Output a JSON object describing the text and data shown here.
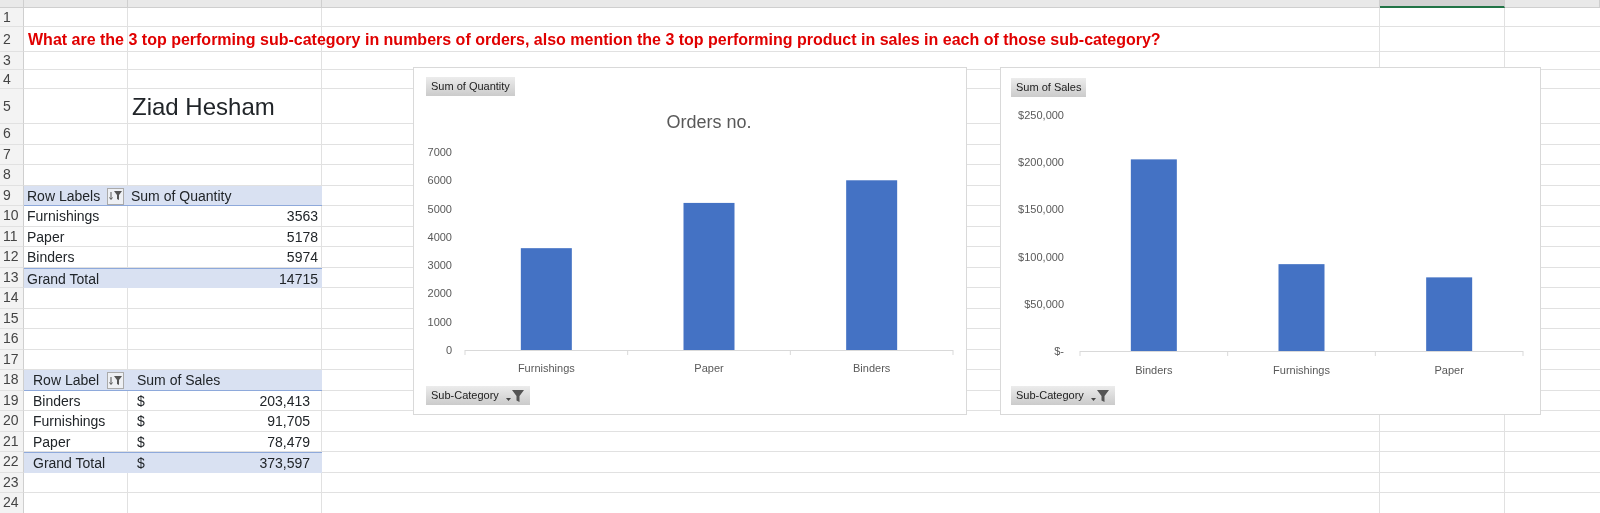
{
  "column_headers": [
    {
      "selected": false
    },
    {
      "selected": false
    },
    {
      "selected": false
    },
    {
      "selected": true
    },
    {
      "selected": false
    }
  ],
  "row_numbers": [
    "1",
    "2",
    "3",
    "4",
    "5",
    "6",
    "7",
    "8",
    "9",
    "10",
    "11",
    "12",
    "13",
    "14",
    "15",
    "16",
    "17",
    "18",
    "19",
    "20",
    "21",
    "22",
    "23",
    "24"
  ],
  "question": "What are the 3 top performing sub-category in numbers of orders, also mention the 3 top performing product in sales in each of those sub-category?",
  "author": "Ziad Hesham",
  "pivot_tables": [
    {
      "row_labels": "Row Labels",
      "value_header": "Sum of Quantity",
      "rows": [
        {
          "label": "Furnishings",
          "value": "3563"
        },
        {
          "label": "Paper",
          "value": "5178"
        },
        {
          "label": "Binders",
          "value": "5974"
        }
      ],
      "total": {
        "label": "Grand Total",
        "value": "14715"
      }
    },
    {
      "row_labels": "Row Label",
      "value_header": "Sum of Sales",
      "rows": [
        {
          "label": "Binders",
          "currency": "$",
          "value": "203,413"
        },
        {
          "label": "Furnishings",
          "currency": "$",
          "value": "91,705"
        },
        {
          "label": "Paper",
          "currency": "$",
          "value": "78,479"
        }
      ],
      "total": {
        "label": "Grand Total",
        "currency": "$",
        "value": "373,597"
      }
    }
  ],
  "charts": [
    {
      "axis_button": "Sub-Category",
      "chart_data": {
        "type": "bar",
        "title": "Orders no.",
        "categories": [
          "Furnishings",
          "Paper",
          "Binders"
        ],
        "series": [
          {
            "name": "Sum of Quantity",
            "color": "#4472c4",
            "values": [
              3600,
              5200,
              6000
            ]
          }
        ],
        "ylim": [
          0,
          7000
        ],
        "yticks": [
          0,
          1000,
          2000,
          3000,
          4000,
          5000,
          6000,
          7000
        ]
      }
    },
    {
      "axis_button": "Sub-Category",
      "chart_data": {
        "type": "bar",
        "categories": [
          "Binders",
          "Furnishings",
          "Paper"
        ],
        "series": [
          {
            "name": "Sum of Sales",
            "color": "#4472c4",
            "values": [
              203000,
              92000,
              78000
            ]
          }
        ],
        "ylim": [
          0,
          250000
        ],
        "yticks": [
          {
            "value": 0,
            "label": "$-"
          },
          {
            "value": 50000,
            "label": "$50,000"
          },
          {
            "value": 100000,
            "label": "$100,000"
          },
          {
            "value": 150000,
            "label": "$150,000"
          },
          {
            "value": 200000,
            "label": "$200,000"
          },
          {
            "value": 250000,
            "label": "$250,000"
          }
        ]
      }
    }
  ]
}
